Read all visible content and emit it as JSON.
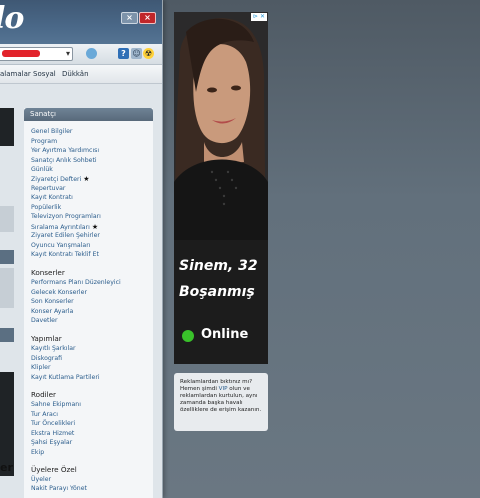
{
  "app": {
    "logo_text": "lo"
  },
  "window": {
    "minimize": "×",
    "close": "×"
  },
  "toolbar": {
    "icon_1": "?",
    "icon_2": "?",
    "icon_3": "☺",
    "icon_4": "☢"
  },
  "menubar": {
    "items": [
      "alamalar",
      "Sosyal",
      "Dükkân"
    ]
  },
  "sidebar": {
    "title": "Sanatçı",
    "items": [
      "Genel Bilgiler",
      "Program",
      "Yer Ayırtma Yardımcısı",
      "Sanatçı Anlık Sohbeti",
      "Günlük",
      "Ziyaretçi Defteri",
      "Repertuvar",
      "Kayıt Kontratı",
      "Popülerlik",
      "Televizyon Programları",
      "Sıralama Ayrıntıları",
      "Ziyaret Edilen Şehirler",
      "Oyuncu Yarışmaları",
      "Kayıt Kontratı Teklif Et"
    ],
    "sections": [
      {
        "title": "Konserler",
        "items": [
          "Performans Planı Düzenleyici",
          "Gelecek Konserler",
          "Son Konserler",
          "Konser Ayarla",
          "Davetler"
        ]
      },
      {
        "title": "Yapımlar",
        "items": [
          "Kayıtlı Şarkılar",
          "Diskografi",
          "Klipler",
          "Kayıt Kutlama Partileri"
        ]
      },
      {
        "title": "Rodiler",
        "items": [
          "Sahne Ekipmanı",
          "Tur Aracı",
          "Tur Öncelikleri",
          "Ekstra Hizmet",
          "Şahsi Eşyalar",
          "Ekip"
        ]
      },
      {
        "title": "Üyelere Özel",
        "items": [
          "Üyeler",
          "Nakit Parayı Yönet"
        ]
      }
    ],
    "left_edge_label": "er"
  },
  "ad": {
    "name_age": "Sinem, 32",
    "status": "Boşanmış",
    "online": "Online",
    "choices": "⊳ ✕"
  },
  "vip_note": {
    "before": "Reklamlardan bıktınız mı? Hemen şimdi ",
    "link": "VIP",
    "after": " olun ve reklamlardan kurtulun, aynı zamanda başka havalı özelliklere de erişim kazanın."
  }
}
